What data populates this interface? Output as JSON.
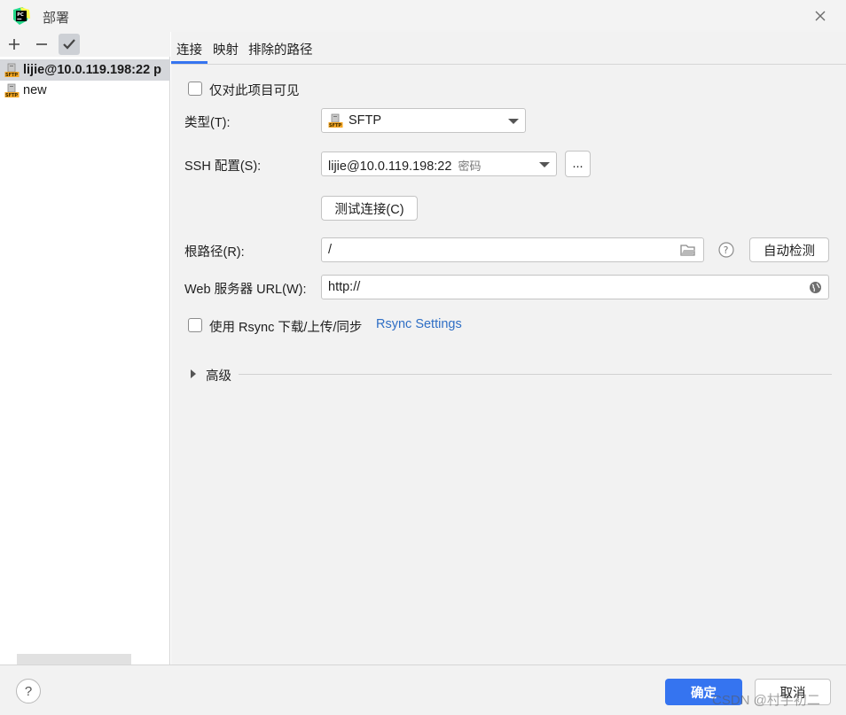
{
  "window": {
    "title": "部署"
  },
  "toolbar": {
    "add": "+",
    "remove": "−",
    "check": "✔"
  },
  "servers": [
    {
      "label": "lijie@10.0.119.198:22 p",
      "icon": "sftp-icon"
    },
    {
      "label": "new",
      "icon": "sftp-icon"
    }
  ],
  "tabs": [
    {
      "label": "连接"
    },
    {
      "label": "映射"
    },
    {
      "label": "排除的路径"
    }
  ],
  "form": {
    "visible_only_label": "仅对此项目可见",
    "type_label": "类型(T):",
    "type_value": "SFTP",
    "ssh_label": "SSH 配置(S):",
    "ssh_value": "lijie@10.0.119.198:22",
    "ssh_hint": "密码",
    "ssh_more": "...",
    "test_button": "测试连接(C)",
    "root_label": "根路径(R):",
    "root_value": "/",
    "auto_detect": "自动检测",
    "web_label": "Web 服务器 URL(W):",
    "web_value": "http://",
    "rsync_label": "使用 Rsync 下载/上传/同步",
    "rsync_link": "Rsync Settings",
    "advanced_label": "高级"
  },
  "footer": {
    "help": "?",
    "ok": "确定",
    "cancel": "取消",
    "watermark": "CSDN @村手初二"
  },
  "colors": {
    "accent": "#3574f0",
    "link": "#2f6fc5",
    "panel": "#f2f2f2"
  }
}
